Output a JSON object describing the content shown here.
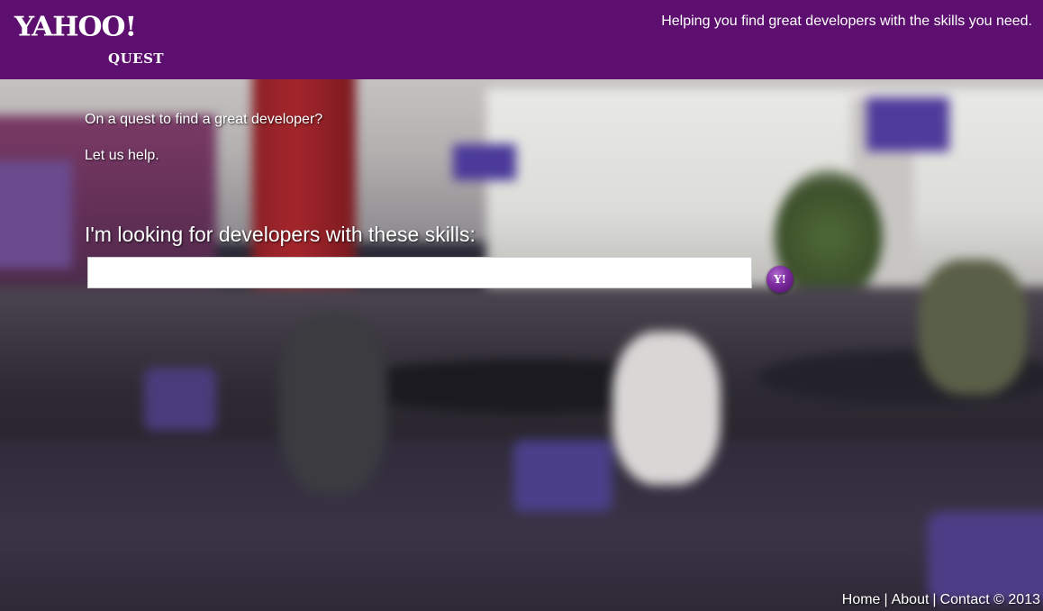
{
  "header": {
    "logo_main": "YAHOO!",
    "logo_sub": "QUEST",
    "tagline": "Helping you find great developers with the skills you need."
  },
  "intro": {
    "line1": "On a quest to find a great developer?",
    "line2": "Let us help."
  },
  "search": {
    "heading": "I'm looking for developers with these skills:",
    "value": "",
    "button_label": "Y!",
    "button_icon": "yahoo-y-icon"
  },
  "footer": {
    "home": "Home",
    "about": "About",
    "contact": "Contact",
    "separator": "|",
    "copyright": "© 2013"
  },
  "colors": {
    "header_bg": "#5c0f6e",
    "text": "#ffffff",
    "button": "#7b2a9d"
  }
}
